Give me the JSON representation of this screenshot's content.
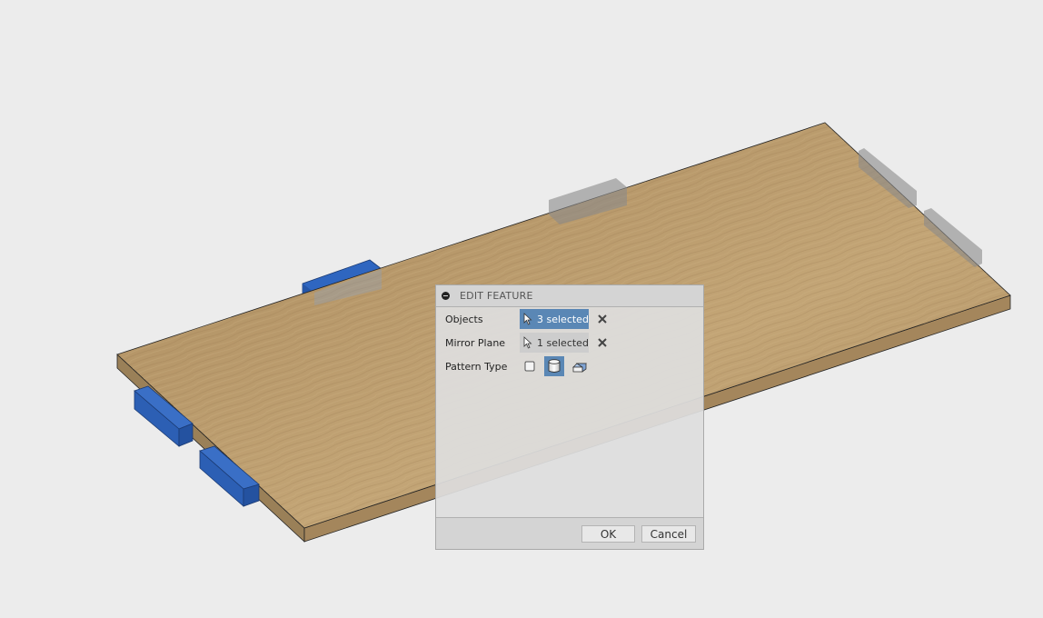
{
  "canvas": {
    "background": "#ececec",
    "model": {
      "board_material": "wood",
      "board_color": "#b99a6c",
      "selected_color": "#2f66c0",
      "preview_color": "#9a9a9a",
      "selected_object_count": 3,
      "mirrored_preview_count": 3
    }
  },
  "dialog": {
    "title": "EDIT FEATURE",
    "rows": {
      "objects": {
        "label": "Objects",
        "value": "3 selected",
        "state": "active"
      },
      "mirror_plane": {
        "label": "Mirror Plane",
        "value": "1 selected",
        "state": "inactive"
      },
      "pattern_type": {
        "label": "Pattern Type",
        "options": [
          {
            "name": "faces",
            "icon": "face-checkbox-icon",
            "selected": false
          },
          {
            "name": "bodies",
            "icon": "body-cylinder-icon",
            "selected": true
          },
          {
            "name": "features",
            "icon": "feature-box-icon",
            "selected": false
          }
        ]
      }
    },
    "buttons": {
      "ok": "OK",
      "cancel": "Cancel"
    },
    "accent_color": "#5a87b5"
  }
}
